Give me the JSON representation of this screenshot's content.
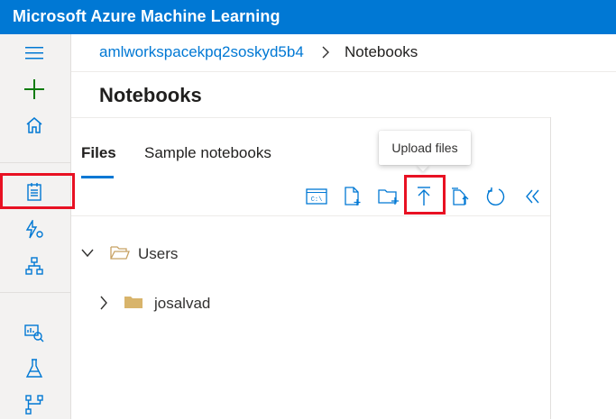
{
  "app": {
    "title": "Microsoft Azure Machine Learning"
  },
  "breadcrumb": {
    "workspace": "amlworkspacekpq2soskyd5b4",
    "separator": ">",
    "current": "Notebooks"
  },
  "page": {
    "title": "Notebooks"
  },
  "tabs": [
    {
      "label": "Files",
      "active": true
    },
    {
      "label": "Sample notebooks",
      "active": false
    }
  ],
  "toolbar": {
    "tooltip": "Upload files",
    "buttons": [
      {
        "icon": "terminal-icon",
        "label": "C:\\"
      },
      {
        "icon": "new-file-icon"
      },
      {
        "icon": "new-folder-icon"
      },
      {
        "icon": "upload-icon"
      },
      {
        "icon": "upload-folder-icon"
      },
      {
        "icon": "refresh-icon"
      },
      {
        "icon": "collapse-icon"
      }
    ]
  },
  "tree": [
    {
      "label": "Users",
      "expanded": true,
      "level": 0
    },
    {
      "label": "josalvad",
      "expanded": false,
      "level": 1
    }
  ],
  "colors": {
    "brand": "#0078d4",
    "highlight": "#e81123",
    "folder": "#d8b46b",
    "add": "#107c10"
  }
}
